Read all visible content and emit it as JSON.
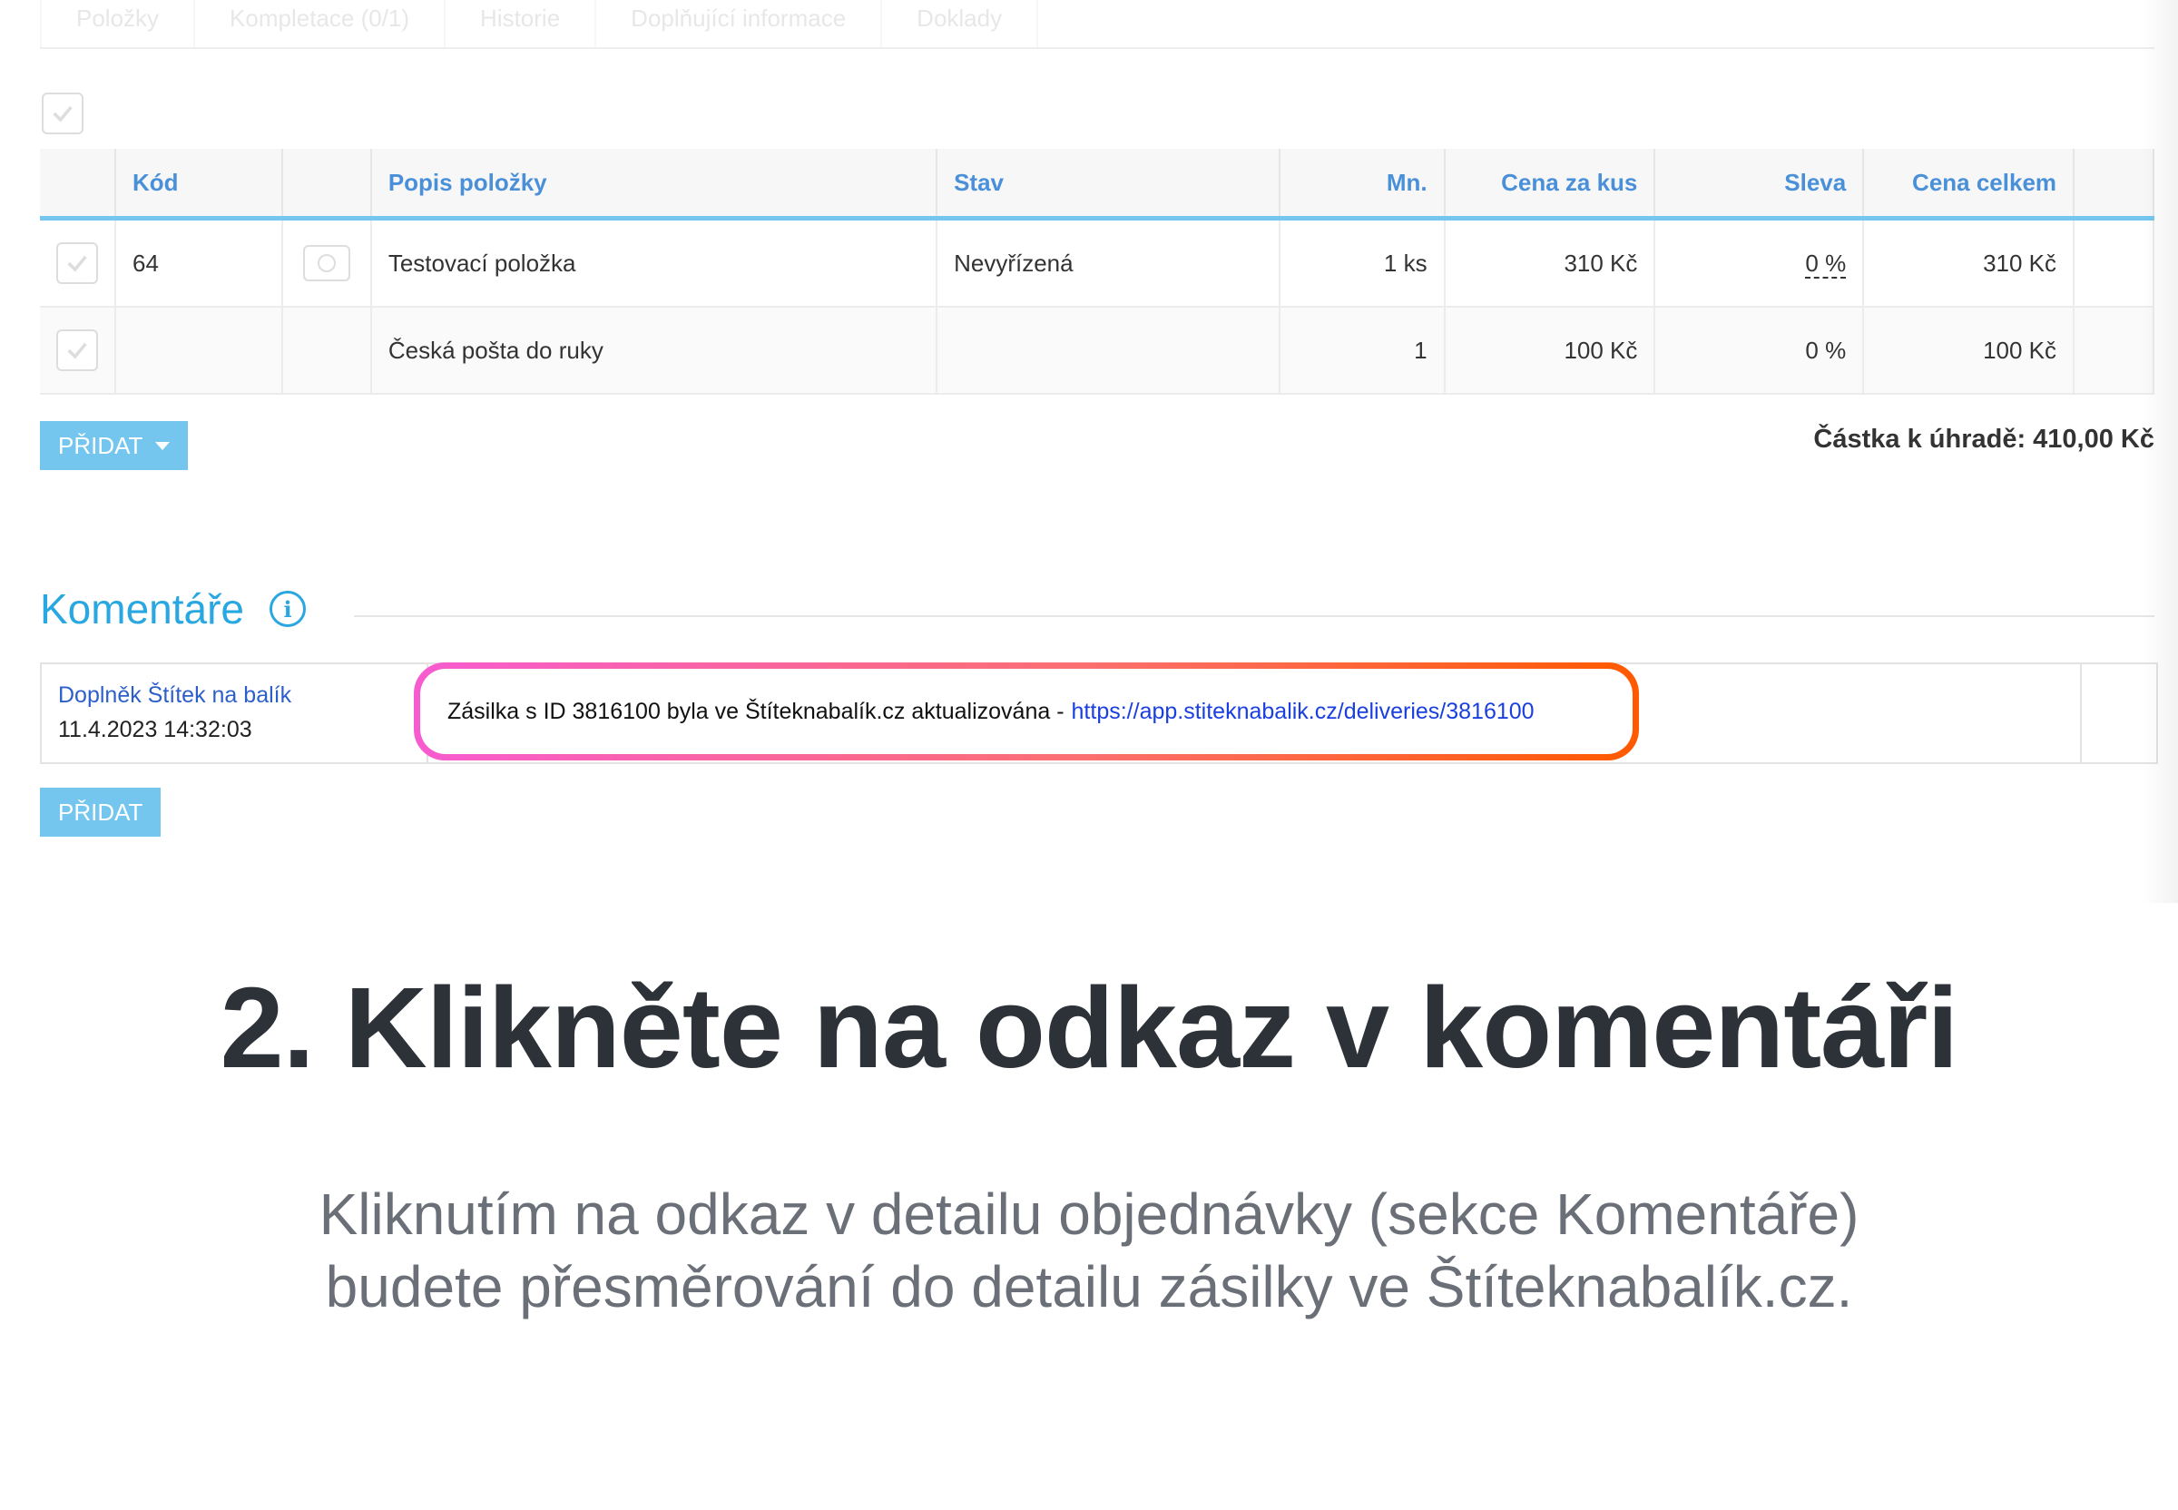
{
  "tabs": [
    "Položky",
    "Kompletace (0/1)",
    "Historie",
    "Doplňující informace",
    "Doklady"
  ],
  "table": {
    "headers": [
      "Kód",
      "",
      "Popis položky",
      "Stav",
      "Mn.",
      "Cena za kus",
      "Sleva",
      "Cena celkem"
    ],
    "rows": [
      {
        "code": "64",
        "description": "Testovací položka",
        "status": "Nevyřízená",
        "qty": "1 ks",
        "unit_price": "310 Kč",
        "discount": "0 %",
        "total": "310 Kč"
      },
      {
        "code": "",
        "description": "Česká pošta do ruky",
        "status": "",
        "qty": "1",
        "unit_price": "100 Kč",
        "discount": "0 %",
        "total": "100 Kč"
      }
    ]
  },
  "add_button_label": "PŘIDAT",
  "total_due": "Částka k úhradě: 410,00 Kč",
  "comments": {
    "title": "Komentáře",
    "info_icon": "i",
    "author": "Doplněk Štítek na balík",
    "date": "11.4.2023 14:32:03",
    "text": "Zásilka s ID 3816100 byla ve Štíteknabalík.cz aktualizována -",
    "link": "https://app.stiteknabalik.cz/deliveries/3816100",
    "add_button_label": "PŘIDAT"
  },
  "instruction": {
    "headline": "2. Klikněte na odkaz v komentáři",
    "line1": "Kliknutím na odkaz v detailu objednávky (sekce Komentáře)",
    "line2": "budete přesměrování do detailu zásilky ve Štíteknabalík.cz."
  },
  "colors": {
    "accent": "#29a7e1",
    "button": "#74c6ef",
    "highlight_start": "#f75bd0",
    "highlight_end": "#ff5a00",
    "green": "#8cc152"
  }
}
